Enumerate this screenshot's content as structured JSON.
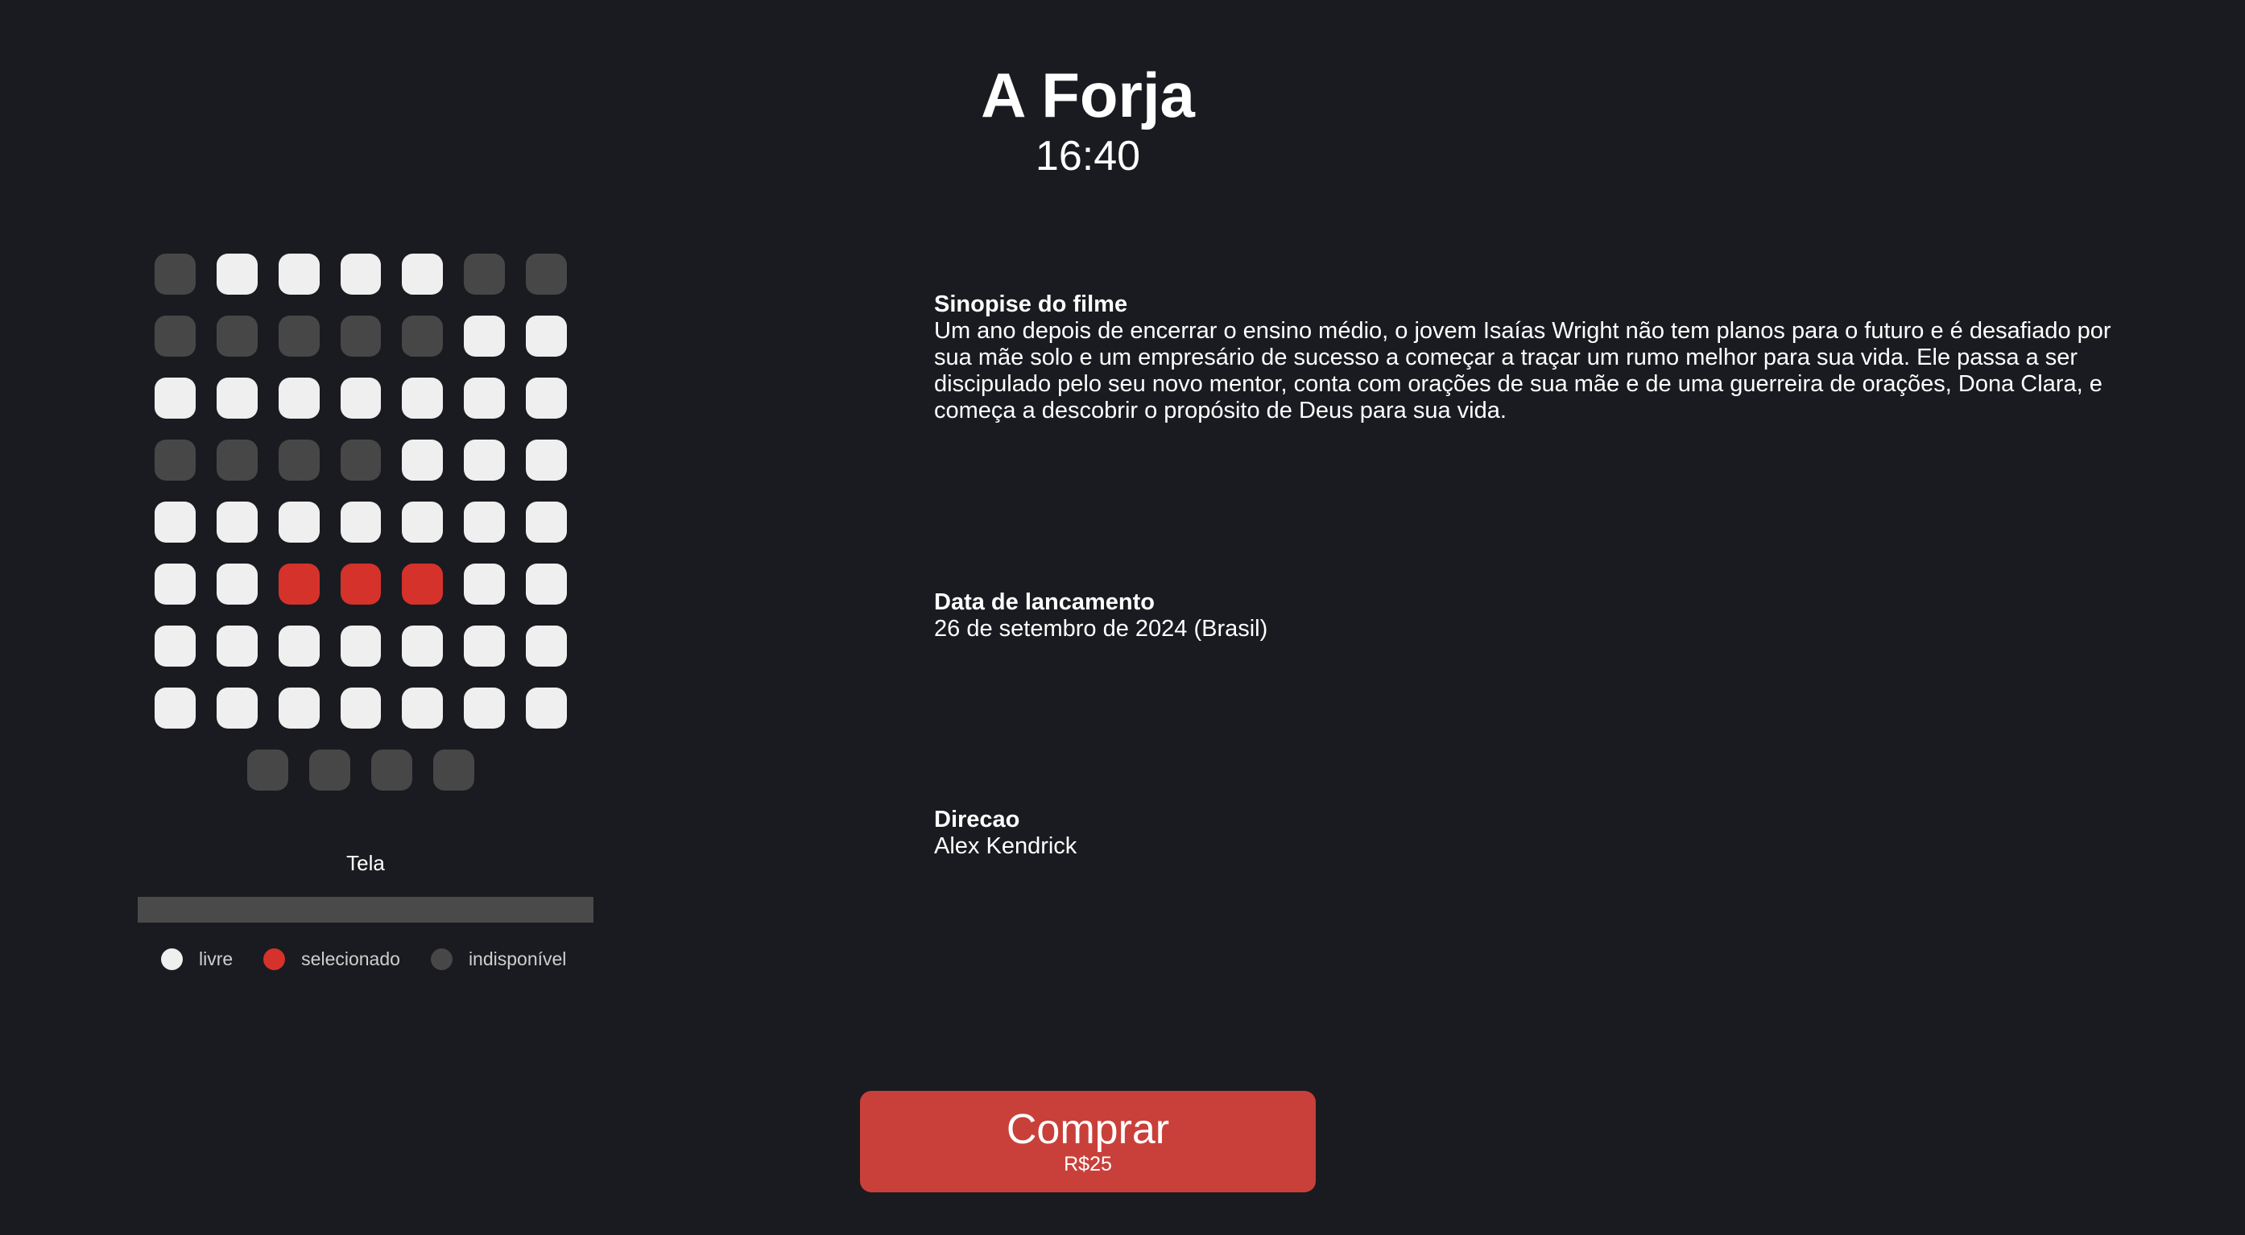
{
  "movie": {
    "title": "A Forja",
    "time": "16:40"
  },
  "seat_map": {
    "rows": [
      [
        "unavailable",
        "free",
        "free",
        "free",
        "free",
        "unavailable",
        "unavailable"
      ],
      [
        "unavailable",
        "unavailable",
        "unavailable",
        "unavailable",
        "unavailable",
        "free",
        "free"
      ],
      [
        "free",
        "free",
        "free",
        "free",
        "free",
        "free",
        "free"
      ],
      [
        "unavailable",
        "unavailable",
        "unavailable",
        "unavailable",
        "free",
        "free",
        "free"
      ],
      [
        "free",
        "free",
        "free",
        "free",
        "free",
        "free",
        "free"
      ],
      [
        "free",
        "free",
        "selected",
        "selected",
        "selected",
        "free",
        "free"
      ],
      [
        "free",
        "free",
        "free",
        "free",
        "free",
        "free",
        "free"
      ],
      [
        "free",
        "free",
        "free",
        "free",
        "free",
        "free",
        "free"
      ],
      [
        "unavailable",
        "unavailable",
        "unavailable",
        "unavailable"
      ]
    ],
    "screen_label": "Tela",
    "legend": {
      "free": "livre",
      "selected": "selecionado",
      "unavailable": "indisponível"
    },
    "colors": {
      "free": "#efefef",
      "selected": "#d5322c",
      "unavailable": "#474747"
    }
  },
  "info": {
    "synopsis_label": "Sinopise do filme",
    "synopsis_text": "Um ano depois de encerrar o ensino médio, o jovem Isaías Wright não tem planos para o futuro e é desafiado por sua mãe solo e um empresário de sucesso a começar a traçar um rumo melhor para sua vida. Ele passa a ser discipulado pelo seu novo mentor, conta com orações de sua mãe e de uma guerreira de orações, Dona Clara, e começa a descobrir o propósito de Deus para sua vida.",
    "release_label": "Data de lancamento",
    "release_text": "26 de setembro de 2024 (Brasil)",
    "direction_label": "Direcao",
    "direction_text": "Alex Kendrick"
  },
  "buy": {
    "label": "Comprar",
    "price": "R$25",
    "color": "#c9403a"
  }
}
